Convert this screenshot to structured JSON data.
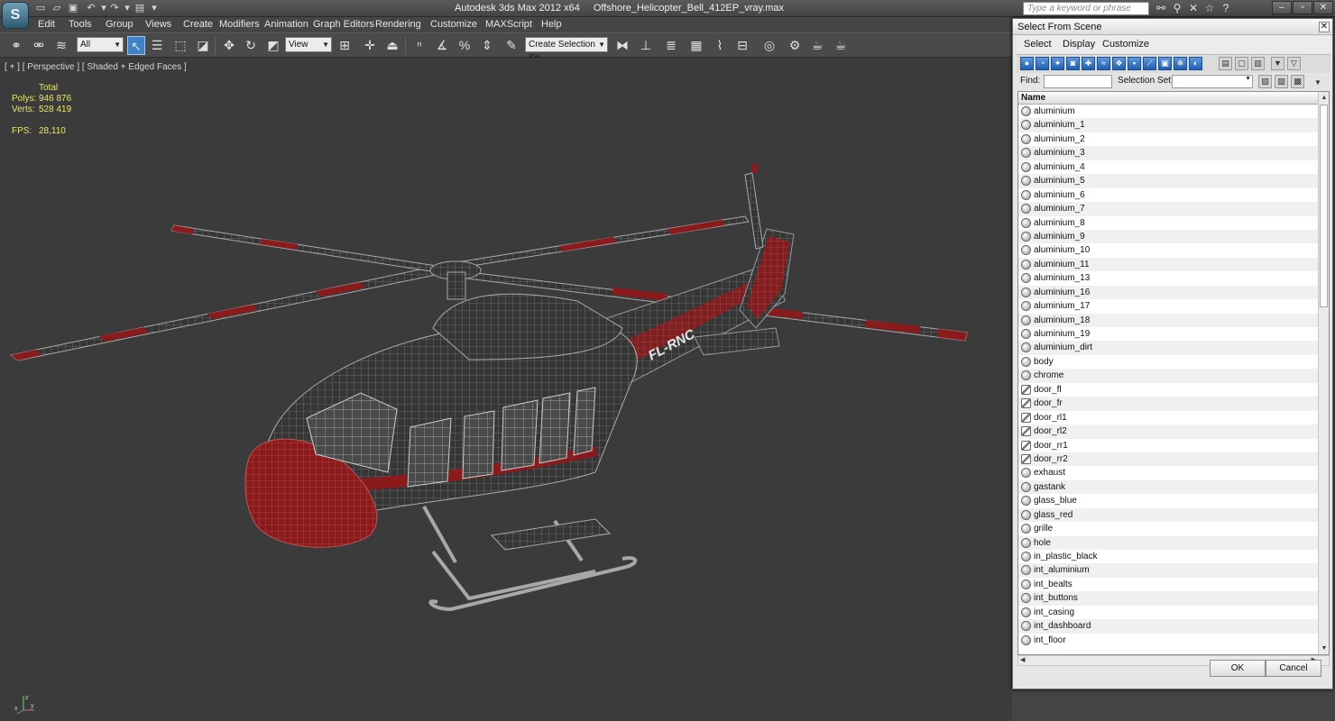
{
  "app": {
    "title": "Autodesk 3ds Max  2012 x64",
    "file": "Offshore_Helicopter_Bell_412EP_vray.max",
    "logo": "S",
    "help_search_placeholder": "Type a keyword or phrase"
  },
  "menu": [
    "Edit",
    "Tools",
    "Group",
    "Views",
    "Create",
    "Modifiers",
    "Animation",
    "Graph Editors",
    "Rendering",
    "Customize",
    "MAXScript",
    "Help"
  ],
  "toolbar": {
    "selection_filter": "All",
    "ref_coord": "View",
    "selection_set_placeholder": "Create Selection Se"
  },
  "viewport": {
    "label": "[ + ] [ Perspective ] [ Shaded + Edged Faces ]",
    "stats": {
      "header": "Total",
      "polys_label": "Polys:",
      "polys_value": "946 876",
      "verts_label": "Verts:",
      "verts_value": "528 419",
      "fps_label": "FPS:",
      "fps_value": "28,110"
    },
    "tail_text": "FL-RNC",
    "axis": {
      "x": "x",
      "y": "y",
      "z": "z"
    }
  },
  "colors": {
    "livery_red": "#8a1a1c",
    "wire": "#9a9a9a",
    "stats_yellow": "#e8e86a",
    "selected_tool": "#3f82c8"
  },
  "dialog": {
    "title": "Select From Scene",
    "menu": [
      "Select",
      "Display",
      "Customize"
    ],
    "find_label": "Find:",
    "find_value": "",
    "selection_set_label": "Selection Set:",
    "selection_set_value": "",
    "column_header": "Name",
    "ok_label": "OK",
    "cancel_label": "Cancel",
    "items": [
      {
        "name": "aluminium",
        "icon": "object"
      },
      {
        "name": "aluminium_1",
        "icon": "object"
      },
      {
        "name": "aluminium_2",
        "icon": "object"
      },
      {
        "name": "aluminium_3",
        "icon": "object"
      },
      {
        "name": "aluminium_4",
        "icon": "object"
      },
      {
        "name": "aluminium_5",
        "icon": "object"
      },
      {
        "name": "aluminium_6",
        "icon": "object"
      },
      {
        "name": "aluminium_7",
        "icon": "object"
      },
      {
        "name": "aluminium_8",
        "icon": "object"
      },
      {
        "name": "aluminium_9",
        "icon": "object"
      },
      {
        "name": "aluminium_10",
        "icon": "object"
      },
      {
        "name": "aluminium_11",
        "icon": "object"
      },
      {
        "name": "aluminium_13",
        "icon": "object"
      },
      {
        "name": "aluminium_16",
        "icon": "object"
      },
      {
        "name": "aluminium_17",
        "icon": "object"
      },
      {
        "name": "aluminium_18",
        "icon": "object"
      },
      {
        "name": "aluminium_19",
        "icon": "object"
      },
      {
        "name": "aluminium_dirt",
        "icon": "object"
      },
      {
        "name": "body",
        "icon": "object"
      },
      {
        "name": "chrome",
        "icon": "object"
      },
      {
        "name": "door_fl",
        "icon": "group"
      },
      {
        "name": "door_fr",
        "icon": "group"
      },
      {
        "name": "door_rl1",
        "icon": "group"
      },
      {
        "name": "door_rl2",
        "icon": "group"
      },
      {
        "name": "door_rr1",
        "icon": "group"
      },
      {
        "name": "door_rr2",
        "icon": "group"
      },
      {
        "name": "exhaust",
        "icon": "object"
      },
      {
        "name": "gastank",
        "icon": "object"
      },
      {
        "name": "glass_blue",
        "icon": "object"
      },
      {
        "name": "glass_red",
        "icon": "object"
      },
      {
        "name": "grille",
        "icon": "object"
      },
      {
        "name": "hole",
        "icon": "object"
      },
      {
        "name": "in_plastic_black",
        "icon": "object"
      },
      {
        "name": "int_aluminium",
        "icon": "object"
      },
      {
        "name": "int_bealts",
        "icon": "object"
      },
      {
        "name": "int_buttons",
        "icon": "object"
      },
      {
        "name": "int_casing",
        "icon": "object"
      },
      {
        "name": "int_dashboard",
        "icon": "object"
      },
      {
        "name": "int_floor",
        "icon": "object"
      }
    ]
  }
}
